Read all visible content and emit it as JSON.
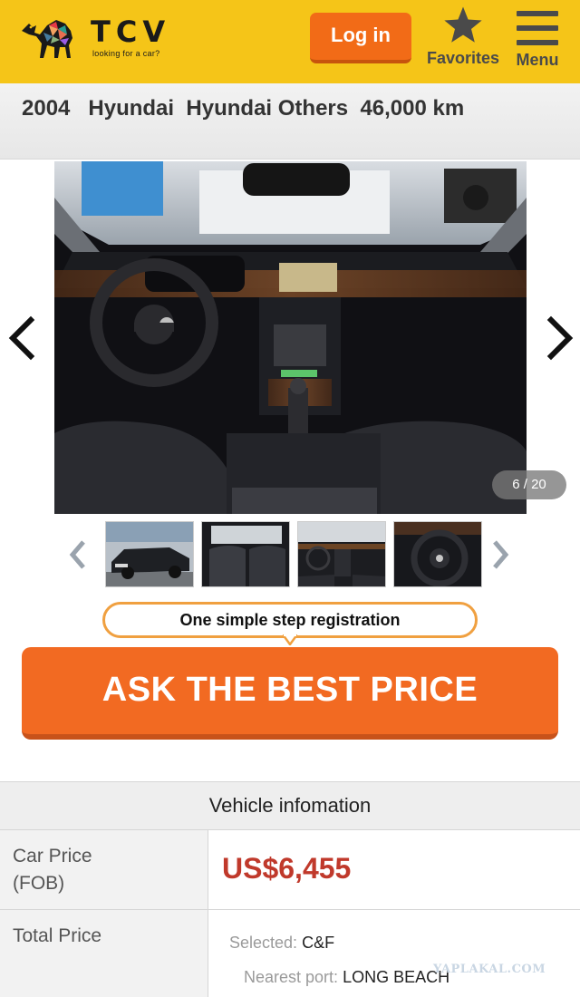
{
  "header": {
    "brand": "TCV",
    "tagline": "looking for a car?",
    "login_label": "Log in",
    "favorites_label": "Favorites",
    "menu_label": "Menu",
    "bg_color": "#f5c518",
    "accent_color": "#f26b17"
  },
  "listing": {
    "title": "2004   Hyundai  Hyundai Others  46,000 km"
  },
  "gallery": {
    "counter": "6 / 20",
    "prev_icon": "chevron-left-icon",
    "next_icon": "chevron-right-icon",
    "thumbnails": [
      {
        "desc": "car-exterior-front"
      },
      {
        "desc": "car-interior-rear-seats"
      },
      {
        "desc": "car-interior-dashboard"
      },
      {
        "desc": "car-steering-wheel"
      }
    ]
  },
  "cta": {
    "registration_text": "One simple step registration",
    "ask_label": "ASK THE BEST PRICE"
  },
  "vehicle_info": {
    "heading": "Vehicle infomation",
    "car_price_label": "Car Price\n(FOB)",
    "car_price_line1": "Car Price",
    "car_price_line2": "(FOB)",
    "car_price_value": "US$6,455",
    "total_price_label": "Total Price",
    "selected_label": "Selected:",
    "selected_value": "C&F",
    "port_label": "Nearest port:",
    "port_value": "LONG BEACH"
  },
  "watermark": "YAPLAKAL.COM"
}
